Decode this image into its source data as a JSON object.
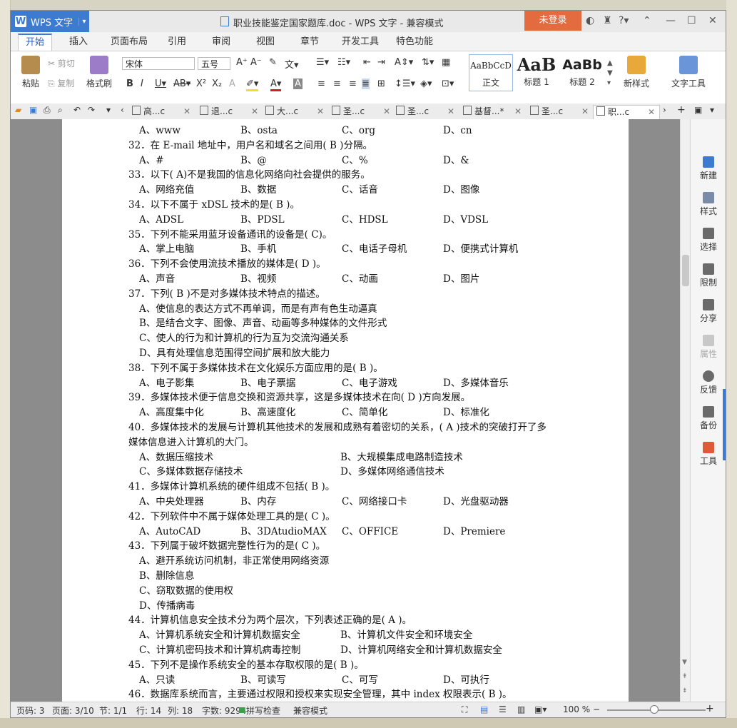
{
  "window": {
    "app_button": "WPS 文字",
    "title": "职业技能鉴定国家题库.doc - WPS 文字 - 兼容模式",
    "login": "未登录"
  },
  "menu_tabs": [
    "开始",
    "插入",
    "页面布局",
    "引用",
    "审阅",
    "视图",
    "章节",
    "开发工具",
    "特色功能"
  ],
  "ribbon": {
    "paste": "粘贴",
    "cut": "剪切",
    "copy": "复制",
    "format_painter": "格式刷",
    "font_name": "宋体",
    "font_size": "五号",
    "styles": [
      {
        "sample": "AaBbCcD",
        "label": "正文"
      },
      {
        "sample": "AaB",
        "label": "标题 1"
      },
      {
        "sample": "AaBb",
        "label": "标题 2"
      }
    ],
    "new_style": "新样式",
    "text_tools": "文字工具"
  },
  "doc_tabs": [
    "高...c",
    "退...c",
    "大...c",
    "圣...c",
    "圣...c",
    "基督...*",
    "圣...c",
    "职...c"
  ],
  "document_lines": [
    {
      "type": "opt",
      "opts": [
        "A、www",
        "B、osta",
        "C、org",
        "D、cn"
      ]
    },
    {
      "type": "q",
      "text": "32．在 E-mail 地址中，用户名和域名之间用(   B   )分隔。"
    },
    {
      "type": "opt",
      "opts": [
        "A、#",
        "B、@",
        "C、%",
        "D、&"
      ]
    },
    {
      "type": "q",
      "text": "33．以下(   A)不是我国的信息化网络向社会提供的服务。"
    },
    {
      "type": "opt",
      "opts": [
        "A、网络充值",
        "B、数据",
        "C、话音",
        "D、图像"
      ]
    },
    {
      "type": "q",
      "text": "34．以下不属于 xDSL 技术的是(   B   )。"
    },
    {
      "type": "opt",
      "opts": [
        "A、ADSL",
        "B、PDSL",
        "C、HDSL",
        "D、VDSL"
      ]
    },
    {
      "type": "q",
      "text": "35．下列不能采用蓝牙设备通讯的设备是(   C)。"
    },
    {
      "type": "opt",
      "opts": [
        "A、掌上电脑",
        "B、手机",
        "C、电话子母机",
        "D、便携式计算机"
      ]
    },
    {
      "type": "q",
      "text": "36．下列不会使用流技术播放的媒体是(   D   )。"
    },
    {
      "type": "opt",
      "opts": [
        "A、声音",
        "B、视频",
        "C、动画",
        "D、图片"
      ]
    },
    {
      "type": "q",
      "text": "37．下列(   B   )不是对多媒体技术特点的描述。"
    },
    {
      "type": "sub",
      "text": "A、使信息的表达方式不再单调，而是有声有色生动逼真"
    },
    {
      "type": "sub",
      "text": "B、是结合文字、图像、声音、动画等多种媒体的文件形式"
    },
    {
      "type": "sub",
      "text": "C、使人的行为和计算机的行为互为交流沟通关系"
    },
    {
      "type": "sub",
      "text": "D、具有处理信息范围得空间扩展和放大能力"
    },
    {
      "type": "q",
      "text": "38．下列不属于多媒体技术在文化娱乐方面应用的是(   B   )。"
    },
    {
      "type": "opt",
      "opts": [
        "A、电子影集",
        "B、电子票据",
        "C、电子游戏",
        "D、多媒体音乐"
      ]
    },
    {
      "type": "q",
      "text": "39．多媒体技术便于信息交换和资源共享，这是多媒体技术在向(   D   )方向发展。"
    },
    {
      "type": "opt",
      "opts": [
        "A、高度集中化",
        "B、高速度化",
        "C、简单化",
        "D、标准化"
      ]
    },
    {
      "type": "q",
      "text": "40．多媒体技术的发展与计算机其他技术的发展和成熟有着密切的关系，(   A   )技术的突破打开了多"
    },
    {
      "type": "q",
      "text": "媒体信息进入计算机的大门。"
    },
    {
      "type": "opt2",
      "opts": [
        "A、数据压缩技术",
        "B、大规模集成电路制造技术"
      ]
    },
    {
      "type": "opt2",
      "opts": [
        "C、多媒体数据存储技术",
        "D、多媒体网络通信技术"
      ]
    },
    {
      "type": "q",
      "text": "41．多媒体计算机系统的硬件组成不包括(   B   )。"
    },
    {
      "type": "opt",
      "opts": [
        "A、中央处理器",
        "B、内存",
        "C、网络接口卡",
        "D、光盘驱动器"
      ]
    },
    {
      "type": "q",
      "text": "42．下列软件中不属于媒体处理工具的是(   C   )。"
    },
    {
      "type": "opt",
      "opts": [
        "A、AutoCAD",
        "B、3DAtudioMAX",
        "C、OFFICE",
        "D、Premiere"
      ]
    },
    {
      "type": "q",
      "text": "43．下列属于破坏数据完整性行为的是(   C   )。"
    },
    {
      "type": "sub",
      "text": "A、避开系统访问机制，非正常使用网络资源"
    },
    {
      "type": "sub",
      "text": "B、删除信息"
    },
    {
      "type": "sub",
      "text": "C、窃取数据的使用权"
    },
    {
      "type": "sub",
      "text": "D、传播病毒"
    },
    {
      "type": "q",
      "text": "44．计算机信息安全技术分为两个层次，下列表述正确的是(   A   )。"
    },
    {
      "type": "opt2",
      "opts": [
        "A、计算机系统安全和计算机数据安全",
        "B、计算机文件安全和环境安全"
      ]
    },
    {
      "type": "opt2",
      "opts": [
        "C、计算机密码技术和计算机病毒控制",
        "D、计算机网络安全和计算机数据安全"
      ]
    },
    {
      "type": "q",
      "text": "45．下列不是操作系统安全的基本存取权限的是(   B   )。"
    },
    {
      "type": "opt",
      "opts": [
        "A、只读",
        "B、可读写",
        "C、可写",
        "D、可执行"
      ]
    },
    {
      "type": "q",
      "text": "46．数据库系统而言，主要通过权限和授权来实现安全管理，其中 index 权限表示(   B   )。"
    }
  ],
  "right_panel": [
    "新建",
    "样式",
    "选择",
    "限制",
    "分享",
    "属性",
    "反馈",
    "备份",
    "工具"
  ],
  "status": {
    "page_code": "页码: 3",
    "pages": "页面: 3/10",
    "section": "节: 1/1",
    "row": "行: 14",
    "col": "列: 18",
    "words": "字数: 9294",
    "spell": "拼写检查",
    "compat": "兼容模式",
    "zoom": "100 %"
  },
  "colors": {
    "accent": "#3d7bd1",
    "login": "#e46b3f"
  }
}
